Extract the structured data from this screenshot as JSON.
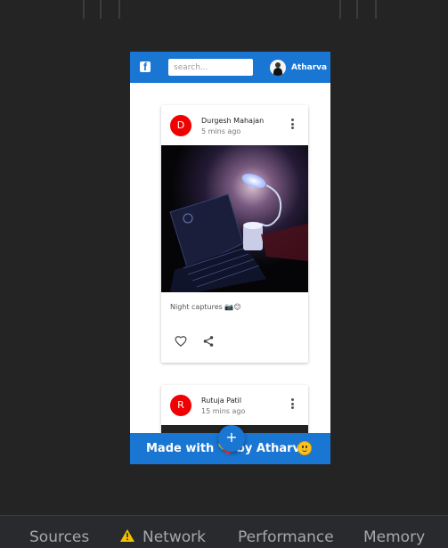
{
  "app": {
    "search_placeholder": "search...",
    "user_name": "Atharva",
    "fab_label": "+",
    "footer_text": "Made with 💊 by Atharva",
    "accent_color": "#1976d2",
    "avatar_color": "#f00000"
  },
  "posts": [
    {
      "initial": "D",
      "author": "Durgesh Mahajan",
      "time": "5 mins ago",
      "caption": "Night captures 📷😊",
      "actions": [
        "heart-icon",
        "share-icon"
      ]
    },
    {
      "initial": "R",
      "author": "Rutuja Patil",
      "time": "15 mins ago"
    }
  ],
  "devtools": {
    "tabs": [
      "Sources",
      "Network",
      "Performance",
      "Memory"
    ]
  }
}
